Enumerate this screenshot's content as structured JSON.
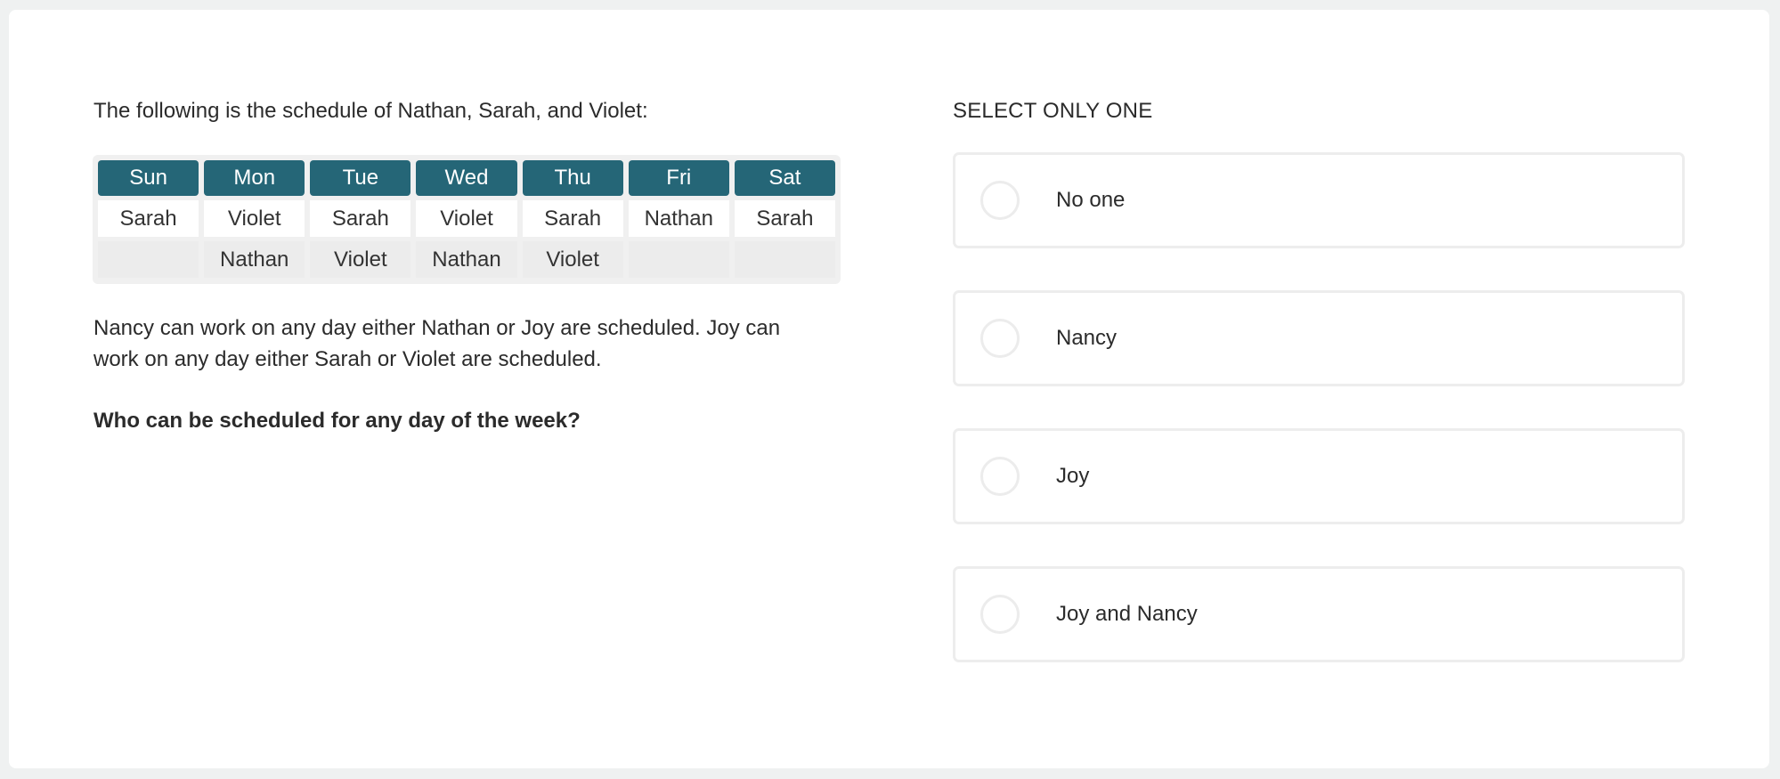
{
  "intro": "The following is the schedule of Nathan, Sarah, and Violet:",
  "schedule": {
    "days": [
      "Sun",
      "Mon",
      "Tue",
      "Wed",
      "Thu",
      "Fri",
      "Sat"
    ],
    "row1": [
      "Sarah",
      "Violet",
      "Sarah",
      "Violet",
      "Sarah",
      "Nathan",
      "Sarah"
    ],
    "row2": [
      "",
      "Nathan",
      "Violet",
      "Nathan",
      "Violet",
      "",
      ""
    ]
  },
  "rules": "Nancy can work on any day either Nathan or Joy are scheduled. Joy can work on any day either Sarah or Violet are scheduled.",
  "question": "Who can be scheduled for any day of the week?",
  "answer_panel": {
    "instruction": "SELECT ONLY ONE",
    "options": [
      {
        "label": "No one",
        "selected": false
      },
      {
        "label": "Nancy",
        "selected": false
      },
      {
        "label": "Joy",
        "selected": false
      },
      {
        "label": "Joy and Nancy",
        "selected": false
      }
    ]
  },
  "colors": {
    "header_bg": "#256677",
    "header_text": "#ffffff",
    "page_bg": "#eff1f1",
    "option_border": "#ededed"
  }
}
